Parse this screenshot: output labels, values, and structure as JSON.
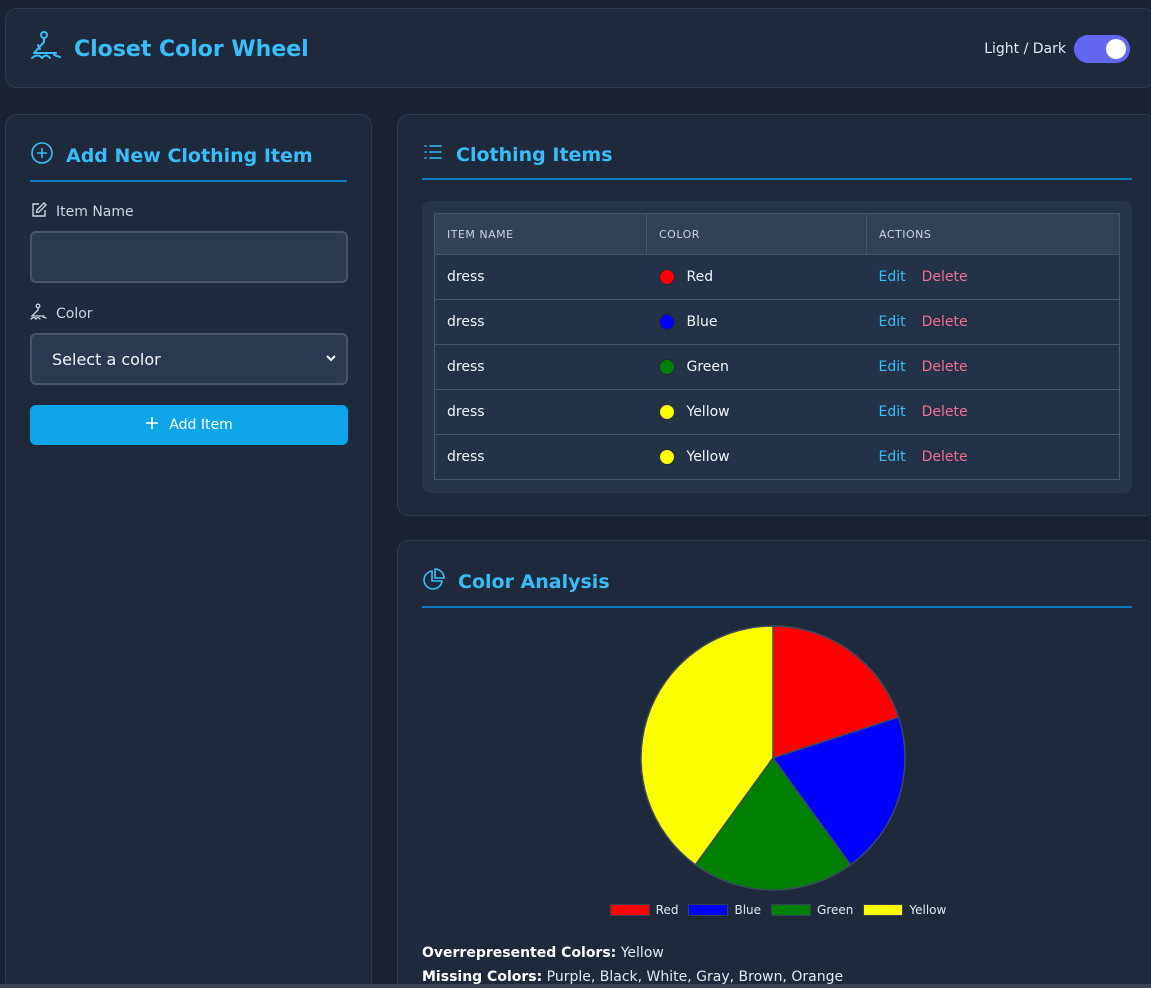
{
  "header": {
    "title": "Closet Color Wheel",
    "theme_toggle_label": "Light / Dark",
    "theme_toggle_on": true
  },
  "form": {
    "title": "Add New Clothing Item",
    "item_name_label": "Item Name",
    "item_name_value": "",
    "color_label": "Color",
    "color_select_value": "Select a color",
    "add_button_label": "Add Item"
  },
  "items": {
    "title": "Clothing Items",
    "columns": [
      "ITEM NAME",
      "COLOR",
      "ACTIONS"
    ],
    "edit_label": "Edit",
    "delete_label": "Delete",
    "rows": [
      {
        "name": "dress",
        "color": "Red",
        "hex": "#ff0000"
      },
      {
        "name": "dress",
        "color": "Blue",
        "hex": "#0000ff"
      },
      {
        "name": "dress",
        "color": "Green",
        "hex": "#008000"
      },
      {
        "name": "dress",
        "color": "Yellow",
        "hex": "#ffff00"
      },
      {
        "name": "dress",
        "color": "Yellow",
        "hex": "#ffff00"
      }
    ]
  },
  "analysis": {
    "title": "Color Analysis",
    "overrepresented_label": "Overrepresented Colors:",
    "overrepresented_value": "Yellow",
    "missing_label": "Missing Colors:",
    "missing_value": "Purple, Black, White, Gray, Brown, Orange"
  },
  "chart_data": {
    "type": "pie",
    "categories": [
      "Red",
      "Blue",
      "Green",
      "Yellow"
    ],
    "values": [
      1,
      1,
      1,
      2
    ],
    "colors": [
      "#ff0000",
      "#0000ff",
      "#008000",
      "#ffff00"
    ],
    "legend_position": "bottom"
  },
  "colors": {
    "accent": "#38bdf8",
    "button": "#0ea5e9",
    "toggle": "#6366f1",
    "delete": "#f07090"
  }
}
